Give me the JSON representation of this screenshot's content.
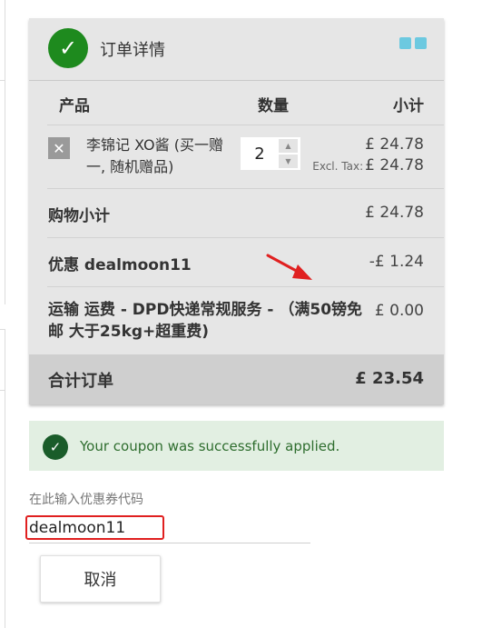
{
  "order": {
    "title": "订单详情",
    "columns": {
      "product": "产品",
      "quantity": "数量",
      "subtotal": "小计"
    },
    "item": {
      "name": "李锦记 XO酱 (买一赠一, 随机赠品)",
      "quantity": "2",
      "price": "£ 24.78",
      "excl_tax_label": "Excl. Tax:",
      "excl_tax_price": "£ 24.78"
    },
    "subtotal": {
      "label": "购物小计",
      "value": "£ 24.78"
    },
    "discount": {
      "label": "优惠 dealmoon11",
      "value": "-£ 1.24"
    },
    "shipping": {
      "label": "运输 运费 - DPD快递常规服务 - （满50镑免邮 大于25kg+超重费)",
      "value": "£ 0.00"
    },
    "grand_total": {
      "label": "合计订单",
      "value": "£ 23.54"
    }
  },
  "message": {
    "success": "Your coupon was successfully applied."
  },
  "coupon": {
    "label": "在此输入优惠券代码",
    "value": "dealmoon11",
    "cancel_label": "取消"
  },
  "colors": {
    "accent_green": "#1e8a1e",
    "success_bg": "#e2efe2",
    "success_text": "#2e6d2e",
    "highlight_red": "#e02020",
    "header_squares": "#6cc9e0"
  }
}
